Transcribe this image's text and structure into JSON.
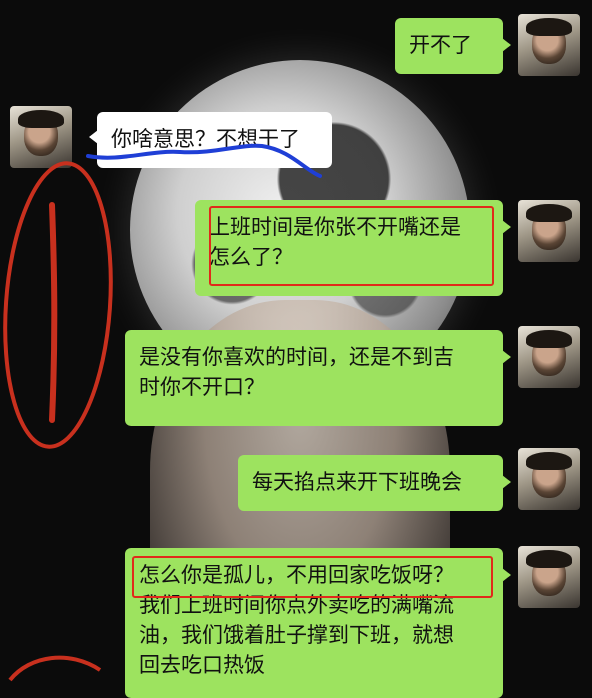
{
  "chat": {
    "messages": [
      {
        "side": "right",
        "lines": [
          "开不了"
        ]
      },
      {
        "side": "left",
        "lines": [
          "你啥意思？不想干了"
        ]
      },
      {
        "side": "right",
        "lines": [
          "上班时间是你张不开嘴还是",
          "怎么了？"
        ]
      },
      {
        "side": "right",
        "lines": [
          "是没有你喜欢的时间，还是不到吉",
          "时你不开口？"
        ]
      },
      {
        "side": "right",
        "lines": [
          "每天掐点来开下班晚会"
        ]
      },
      {
        "side": "right",
        "lines": [
          "怎么你是孤儿，不用回家吃饭呀？",
          "我们上班时间你点外卖吃的满嘴流",
          "油，我们饿着肚子撑到下班，就想",
          "回去吃口热饭"
        ]
      }
    ]
  },
  "colors": {
    "green_bubble": "#9de35f",
    "white_bubble": "#ffffff",
    "annotation_red": "#e02a1a",
    "annotation_blue": "#1f3fd6"
  }
}
